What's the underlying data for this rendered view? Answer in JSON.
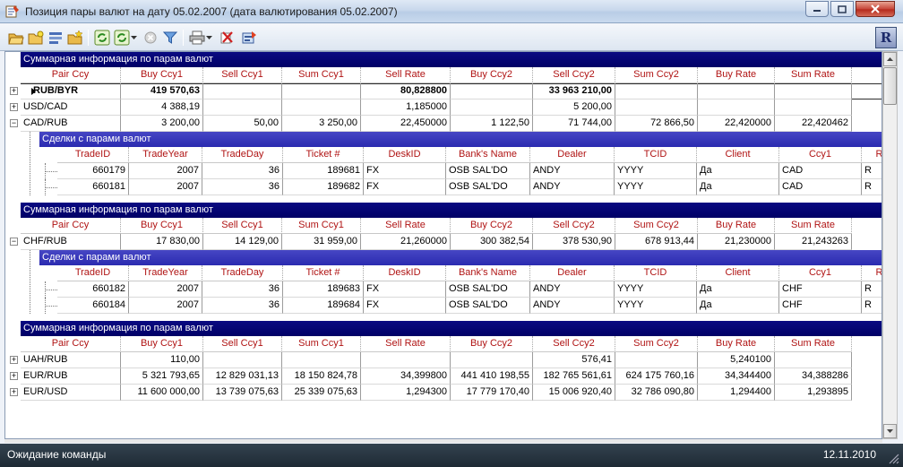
{
  "window": {
    "title": "Позиция пары валют на дату 05.02.2007 (дата валютирования 05.02.2007)"
  },
  "colors": {
    "group_header": "#000066",
    "sub_header": "#2b2bb0",
    "column_header_text": "#b01414",
    "status_bg": "#1e2a34"
  },
  "toolbar": {
    "icons": [
      "open-folder-icon",
      "new-folder-icon",
      "list-icon",
      "folder-star-icon",
      "refresh-icon",
      "refresh-dropdown-icon",
      "stop-icon",
      "filter-icon",
      "print-icon",
      "print-dropdown-icon",
      "delete-icon",
      "export-icon",
      "app-logo-icon"
    ],
    "logo_letter": "R"
  },
  "summary_title": "Суммарная информация по парам валют",
  "deals_title": "Сделки с парами валют",
  "summary_columns": [
    "Pair Ccy",
    "Buy Ccy1",
    "Sell Ccy1",
    "Sum Ccy1",
    "Sell Rate",
    "Buy Ccy2",
    "Sell Ccy2",
    "Sum Ccy2",
    "Buy Rate",
    "Sum Rate"
  ],
  "deal_columns": [
    "TradeID",
    "TradeYear",
    "TradeDay",
    "Ticket #",
    "DeskID",
    "Bank's Name",
    "Dealer",
    "TCID",
    "Client",
    "Ccy1",
    "R"
  ],
  "groups": [
    {
      "rows": [
        {
          "cells": [
            "RUB/BYR",
            "419 570,63",
            "",
            "",
            "80,828800",
            "",
            "33 963 210,00",
            "",
            "",
            ""
          ],
          "expander": "+",
          "selected": true
        },
        {
          "cells": [
            "USD/CAD",
            "4 388,19",
            "",
            "",
            "1,185000",
            "",
            "5 200,00",
            "",
            "",
            ""
          ],
          "expander": "+"
        },
        {
          "cells": [
            "CAD/RUB",
            "3 200,00",
            "50,00",
            "3 250,00",
            "22,450000",
            "1 122,50",
            "71 744,00",
            "72 866,50",
            "22,420000",
            "22,420462"
          ],
          "expander": "−"
        }
      ],
      "deals": [
        [
          "660179",
          "2007",
          "36",
          "189681",
          "FX",
          "OSB SAL'DO",
          "ANDY",
          "YYYY",
          "Да",
          "CAD",
          "R"
        ],
        [
          "660181",
          "2007",
          "36",
          "189682",
          "FX",
          "OSB SAL'DO",
          "ANDY",
          "YYYY",
          "Да",
          "CAD",
          "R"
        ]
      ]
    },
    {
      "rows": [
        {
          "cells": [
            "CHF/RUB",
            "17 830,00",
            "14 129,00",
            "31 959,00",
            "21,260000",
            "300 382,54",
            "378 530,90",
            "678 913,44",
            "21,230000",
            "21,243263"
          ],
          "expander": "−"
        }
      ],
      "deals": [
        [
          "660182",
          "2007",
          "36",
          "189683",
          "FX",
          "OSB SAL'DO",
          "ANDY",
          "YYYY",
          "Да",
          "CHF",
          "R"
        ],
        [
          "660184",
          "2007",
          "36",
          "189684",
          "FX",
          "OSB SAL'DO",
          "ANDY",
          "YYYY",
          "Да",
          "CHF",
          "R"
        ]
      ]
    },
    {
      "rows": [
        {
          "cells": [
            "UAH/RUB",
            "110,00",
            "",
            "",
            "",
            "",
            "576,41",
            "",
            "5,240100",
            ""
          ],
          "expander": "+"
        },
        {
          "cells": [
            "EUR/RUB",
            "5 321 793,65",
            "12 829 031,13",
            "18 150 824,78",
            "34,399800",
            "441 410 198,55",
            "182 765 561,61",
            "624 175 760,16",
            "34,344400",
            "34,388286"
          ],
          "expander": "+"
        },
        {
          "cells": [
            "EUR/USD",
            "11 600 000,00",
            "13 739 075,63",
            "25 339 075,63",
            "1,294300",
            "17 779 170,40",
            "15 006 920,40",
            "32 786 090,80",
            "1,294400",
            "1,293895"
          ],
          "expander": "+"
        }
      ],
      "deals": []
    }
  ],
  "status": {
    "message": "Ожидание команды",
    "date": "12.11.2010"
  }
}
